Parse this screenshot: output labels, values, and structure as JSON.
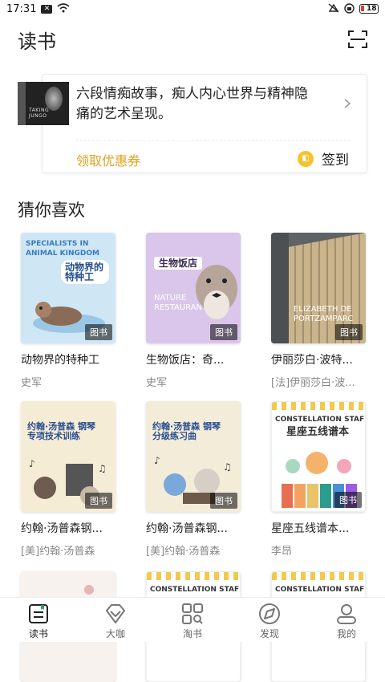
{
  "status": {
    "time": "17:31",
    "battery": "18"
  },
  "header": {
    "title": "读书"
  },
  "promo": {
    "description": "六段情痴故事，痴人内心世界与精神隐痛的艺术呈现。",
    "cover_caption": "TAKING JUNGO",
    "coupon_label": "领取优惠券",
    "signin_label": "签到"
  },
  "section": {
    "title": "猜你喜欢"
  },
  "books": [
    {
      "title": "动物界的特种工",
      "author": "史军",
      "tag": "图书",
      "cover_title": "动物界的特种工",
      "cover_sub": "SPECIALISTS IN ANIMAL KINGDOM"
    },
    {
      "title": "生物饭店：奇...",
      "author": "史军",
      "tag": "图书",
      "cover_title": "生物饭店",
      "cover_sub": "NATURE RESTAURANT"
    },
    {
      "title": "伊丽莎白·波特...",
      "author": "[法]伊丽莎白·波...",
      "tag": "图书",
      "cover_title": "ELIZABETH DE PORTZAMPARC",
      "cover_sub": ""
    },
    {
      "title": "约翰·汤普森钢...",
      "author": "[美]约翰·汤普森",
      "tag": "图书",
      "cover_title": "约翰·汤普森 钢琴专项技术训练",
      "cover_sub": ""
    },
    {
      "title": "约翰·汤普森钢...",
      "author": "[美]约翰·汤普森",
      "tag": "图书",
      "cover_title": "约翰·汤普森 钢琴分级练习曲",
      "cover_sub": ""
    },
    {
      "title": "星座五线谱本...",
      "author": "李昂",
      "tag": "图书",
      "cover_title": "星座五线谱本",
      "cover_sub": "CONSTELLATION STAF"
    },
    {
      "title": "",
      "author": "",
      "tag": "",
      "cover_title": "",
      "cover_sub": ""
    },
    {
      "title": "",
      "author": "",
      "tag": "",
      "cover_title": "",
      "cover_sub": "CONSTELLATION STAF"
    },
    {
      "title": "",
      "author": "",
      "tag": "",
      "cover_title": "",
      "cover_sub": "CONSTELLATION STAF"
    }
  ],
  "tabs": [
    {
      "label": "读书",
      "icon": "book-icon",
      "active": true
    },
    {
      "label": "大咖",
      "icon": "diamond-icon",
      "active": false
    },
    {
      "label": "淘书",
      "icon": "grid-search-icon",
      "active": false
    },
    {
      "label": "发现",
      "icon": "compass-icon",
      "active": false
    },
    {
      "label": "我的",
      "icon": "profile-icon",
      "active": false
    }
  ],
  "colors": {
    "accent": "#e0a21e",
    "signin": "#f6c22e",
    "tab_active": "#2e9b6b"
  }
}
